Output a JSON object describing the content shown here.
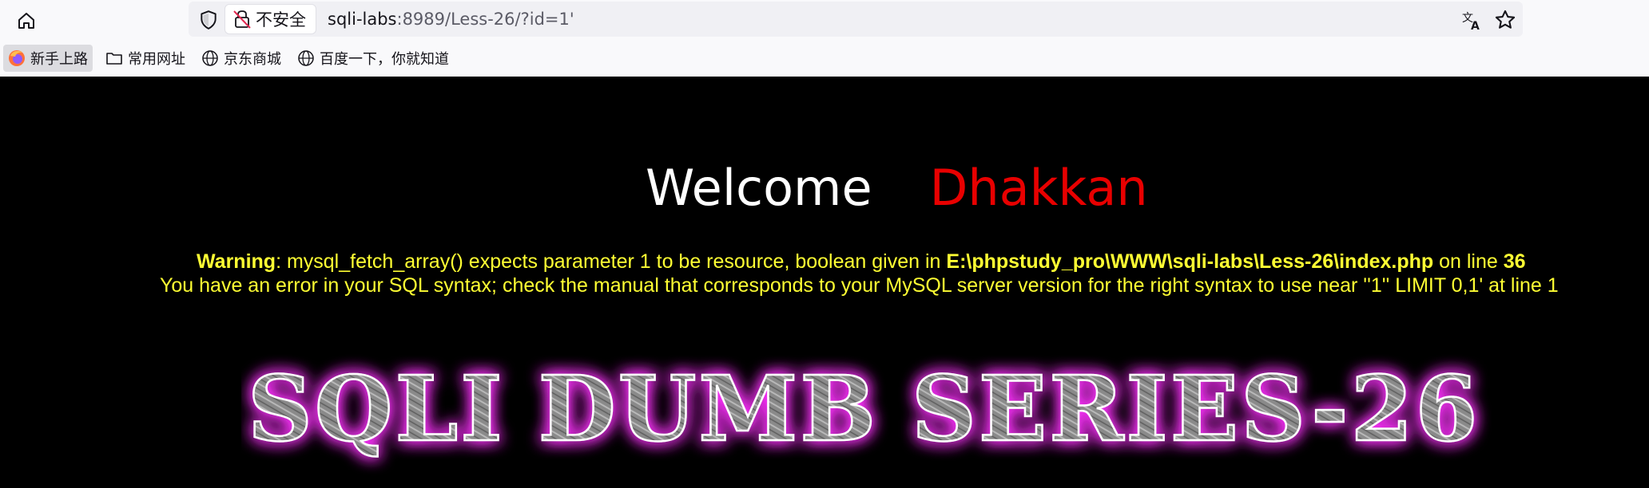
{
  "browser": {
    "security_label": "不安全",
    "url_host": "sqli-labs",
    "url_rest": ":8989/Less-26/?id=1'",
    "icons": {
      "home": "home-icon",
      "shield": "shield-icon",
      "insecure": "insecure-lock-icon",
      "translate": "translate-icon",
      "star": "star-icon"
    }
  },
  "bookmarks": [
    {
      "label": "新手上路",
      "icon": "firefox-icon"
    },
    {
      "label": "常用网址",
      "icon": "folder-icon"
    },
    {
      "label": "京东商城",
      "icon": "globe-icon"
    },
    {
      "label": "百度一下，你就知道",
      "icon": "globe-icon"
    }
  ],
  "page": {
    "welcome": "Welcome",
    "name": "Dhakkan",
    "warning_label": "Warning",
    "warning_text": ": mysql_fetch_array() expects parameter 1 to be resource, boolean given in ",
    "warning_path": "E:\\phpstudy_pro\\WWW\\sqli-labs\\Less-26\\index.php",
    "warning_on_line": " on line ",
    "warning_line_no": "36",
    "sql_error": "You have an error in your SQL syntax; check the manual that corresponds to your MySQL server version for the right syntax to use near ''1'' LIMIT 0,1' at line 1",
    "banner": "SQLI DUMB SERIES-26"
  },
  "colors": {
    "page_bg": "#000000",
    "welcome": "#ffffff",
    "name": "#e80000",
    "warning_text": "#ffff33",
    "banner_glow": "#ff33ff",
    "banner_fill": "#8e8e8e"
  }
}
